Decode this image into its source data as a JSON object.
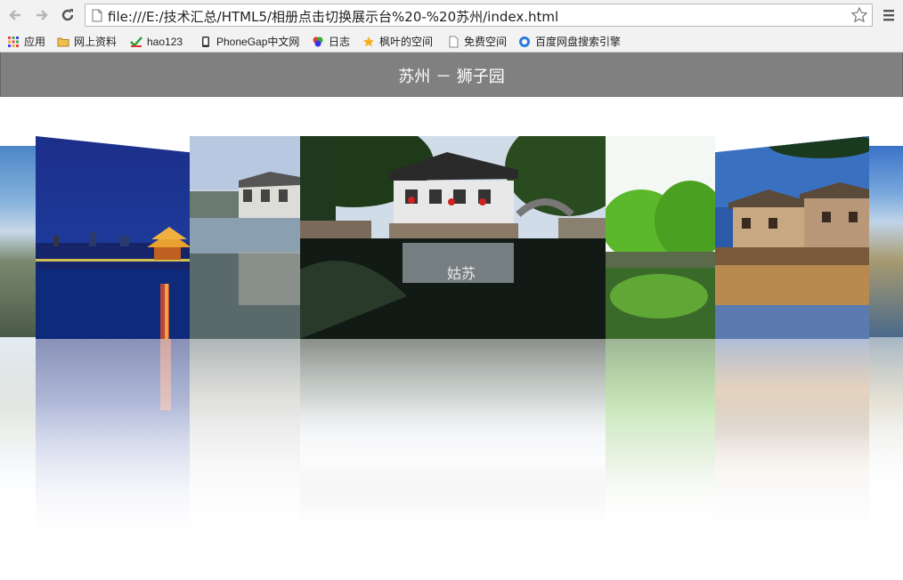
{
  "browser": {
    "url": "file:///E:/技术汇总/HTML5/相册点击切换展示台%20-%20苏州/index.html",
    "bookmarks": [
      {
        "label": "应用",
        "icon": "apps-grid-icon"
      },
      {
        "label": "网上资料",
        "icon": "folder-icon"
      },
      {
        "label": "hao123",
        "icon": "hao123-icon"
      },
      {
        "label": "PhoneGap中文网",
        "icon": "phonegap-icon"
      },
      {
        "label": "日志",
        "icon": "colorful-flower-icon"
      },
      {
        "label": "枫叶的空间",
        "icon": "star-badge-icon"
      },
      {
        "label": "免费空间",
        "icon": "page-icon"
      },
      {
        "label": "百度网盘搜索引擎",
        "icon": "cloud-icon"
      }
    ]
  },
  "page": {
    "title": "苏州 － 狮子园"
  },
  "gallery": {
    "photos": [
      {
        "name": "edge-left",
        "description": "city skyline"
      },
      {
        "name": "night-pavilion",
        "description": "night lake pavilion"
      },
      {
        "name": "canal-houses",
        "description": "canal with houses"
      },
      {
        "name": "water-town-bridge",
        "description": "water town with red lanterns and bridge"
      },
      {
        "name": "willow-pond",
        "description": "green willows over pond"
      },
      {
        "name": "old-houses",
        "description": "old riverside houses"
      },
      {
        "name": "edge-right",
        "description": "blue sky riverside"
      }
    ]
  },
  "colors": {
    "header_bg": "#808080",
    "header_text": "#ffffff",
    "chrome_bg": "#f2f2f2"
  }
}
